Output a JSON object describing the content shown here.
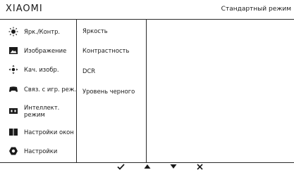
{
  "header": {
    "brand": "XIAOMI",
    "mode": "Стандартный режим"
  },
  "menu": {
    "items": [
      {
        "label": "Ярк./Контр.",
        "icon": "sun-icon"
      },
      {
        "label": "Изображение",
        "icon": "image-icon"
      },
      {
        "label": "Кач. изобр.",
        "icon": "picture-quality-icon"
      },
      {
        "label": "Связ. с игр. реж.",
        "icon": "gamepad-icon"
      },
      {
        "label": "Интеллект. режим",
        "icon": "smart-mode-icon"
      },
      {
        "label": "Настройки окон",
        "icon": "window-settings-icon"
      },
      {
        "label": "Настройки",
        "icon": "settings-icon"
      }
    ]
  },
  "submenu": {
    "items": [
      "Яркость",
      "Контрастность",
      "DCR",
      "Уровень черного"
    ]
  },
  "footer": {
    "keys": [
      {
        "icon": "checkmark-icon"
      },
      {
        "icon": "arrow-up-icon"
      },
      {
        "icon": "arrow-down-icon"
      },
      {
        "icon": "close-icon"
      }
    ]
  },
  "colors": {
    "text": "#1a1a1a",
    "border": "#2a2a2a",
    "background": "#ffffff"
  }
}
